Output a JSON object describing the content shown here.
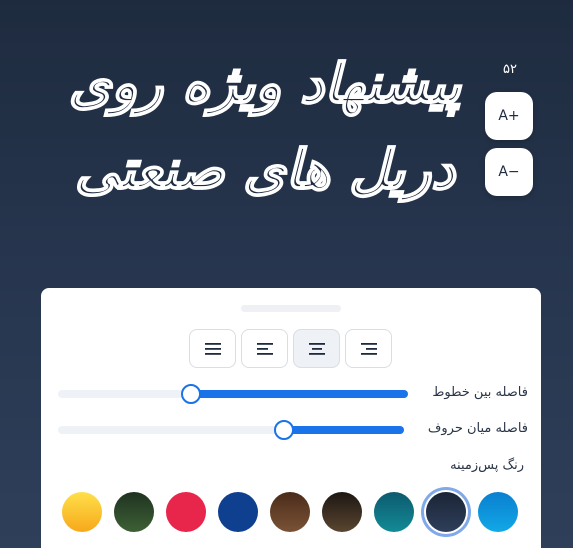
{
  "preview": {
    "line1": "پیشنهاد ویژه روی",
    "line2": "دریل های صنعتی"
  },
  "font_size": {
    "value": "۵۲",
    "increase_label": "A+",
    "decrease_label": "A−"
  },
  "alignment": {
    "options": [
      "justify",
      "left",
      "center",
      "right"
    ],
    "selected": "center"
  },
  "sliders": [
    {
      "label": "فاصله بین خطوط",
      "value": 0.62
    },
    {
      "label": "فاصله میان حروف",
      "value": 0.34
    }
  ],
  "background": {
    "label": "رنگ پس‌زمینه",
    "colors": [
      "#ffcc33",
      "#2c4a2a",
      "#e8254a",
      "#0f3f8f",
      "#5a3a24",
      "#3a2c20",
      "#0f6f80",
      "#1e2b3f",
      "#0d8fd8"
    ],
    "selected": "#1e2b3f"
  },
  "colors": {
    "accent": "#1a73e8",
    "page_bg": "#1e2b3f"
  }
}
